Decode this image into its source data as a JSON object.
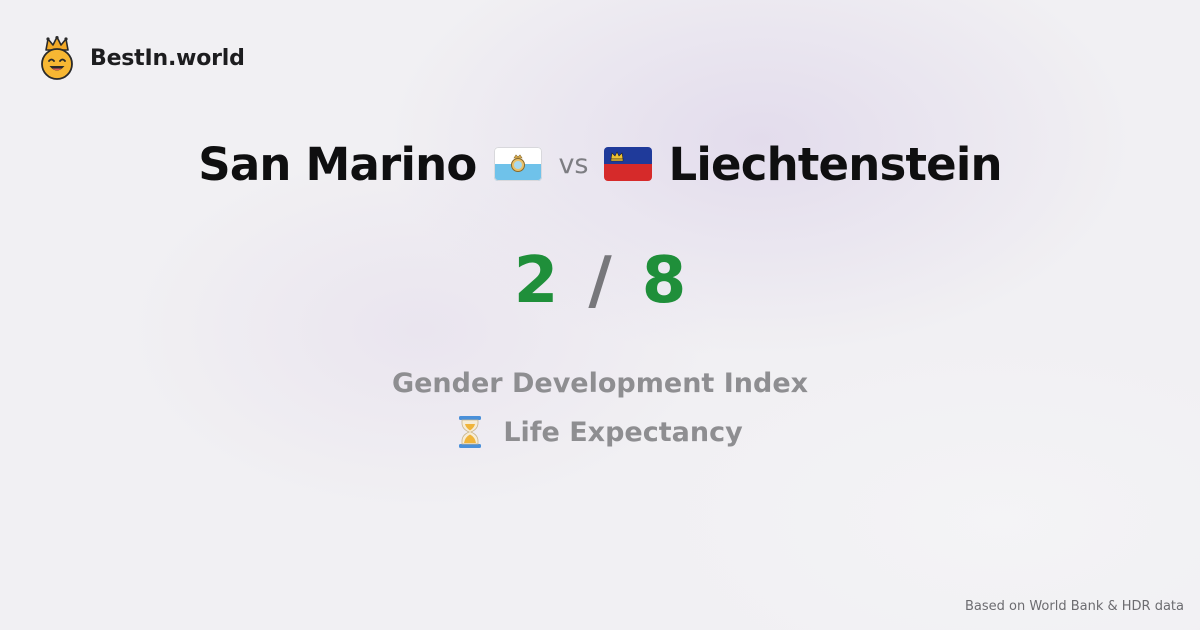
{
  "brand": {
    "name": "BestIn.world",
    "logo_icon": "crowned-smiley-icon"
  },
  "comparison": {
    "left_country": "San Marino",
    "left_flag_icon": "san-marino-flag-icon",
    "vs_label": "vs",
    "right_country": "Liechtenstein",
    "right_flag_icon": "liechtenstein-flag-icon",
    "left_score": "2",
    "separator": "/",
    "right_score": "8"
  },
  "metrics": {
    "primary": "Gender Development Index",
    "secondary_icon": "hourglass-icon",
    "secondary": "Life Expectancy"
  },
  "footer": {
    "source": "Based on World Bank & HDR data"
  },
  "colors": {
    "score": "#1f8f3a",
    "separator": "#77777b",
    "metric_text": "#8e8e91",
    "country_text": "#0f0f10",
    "background": "#f1f0f3"
  }
}
